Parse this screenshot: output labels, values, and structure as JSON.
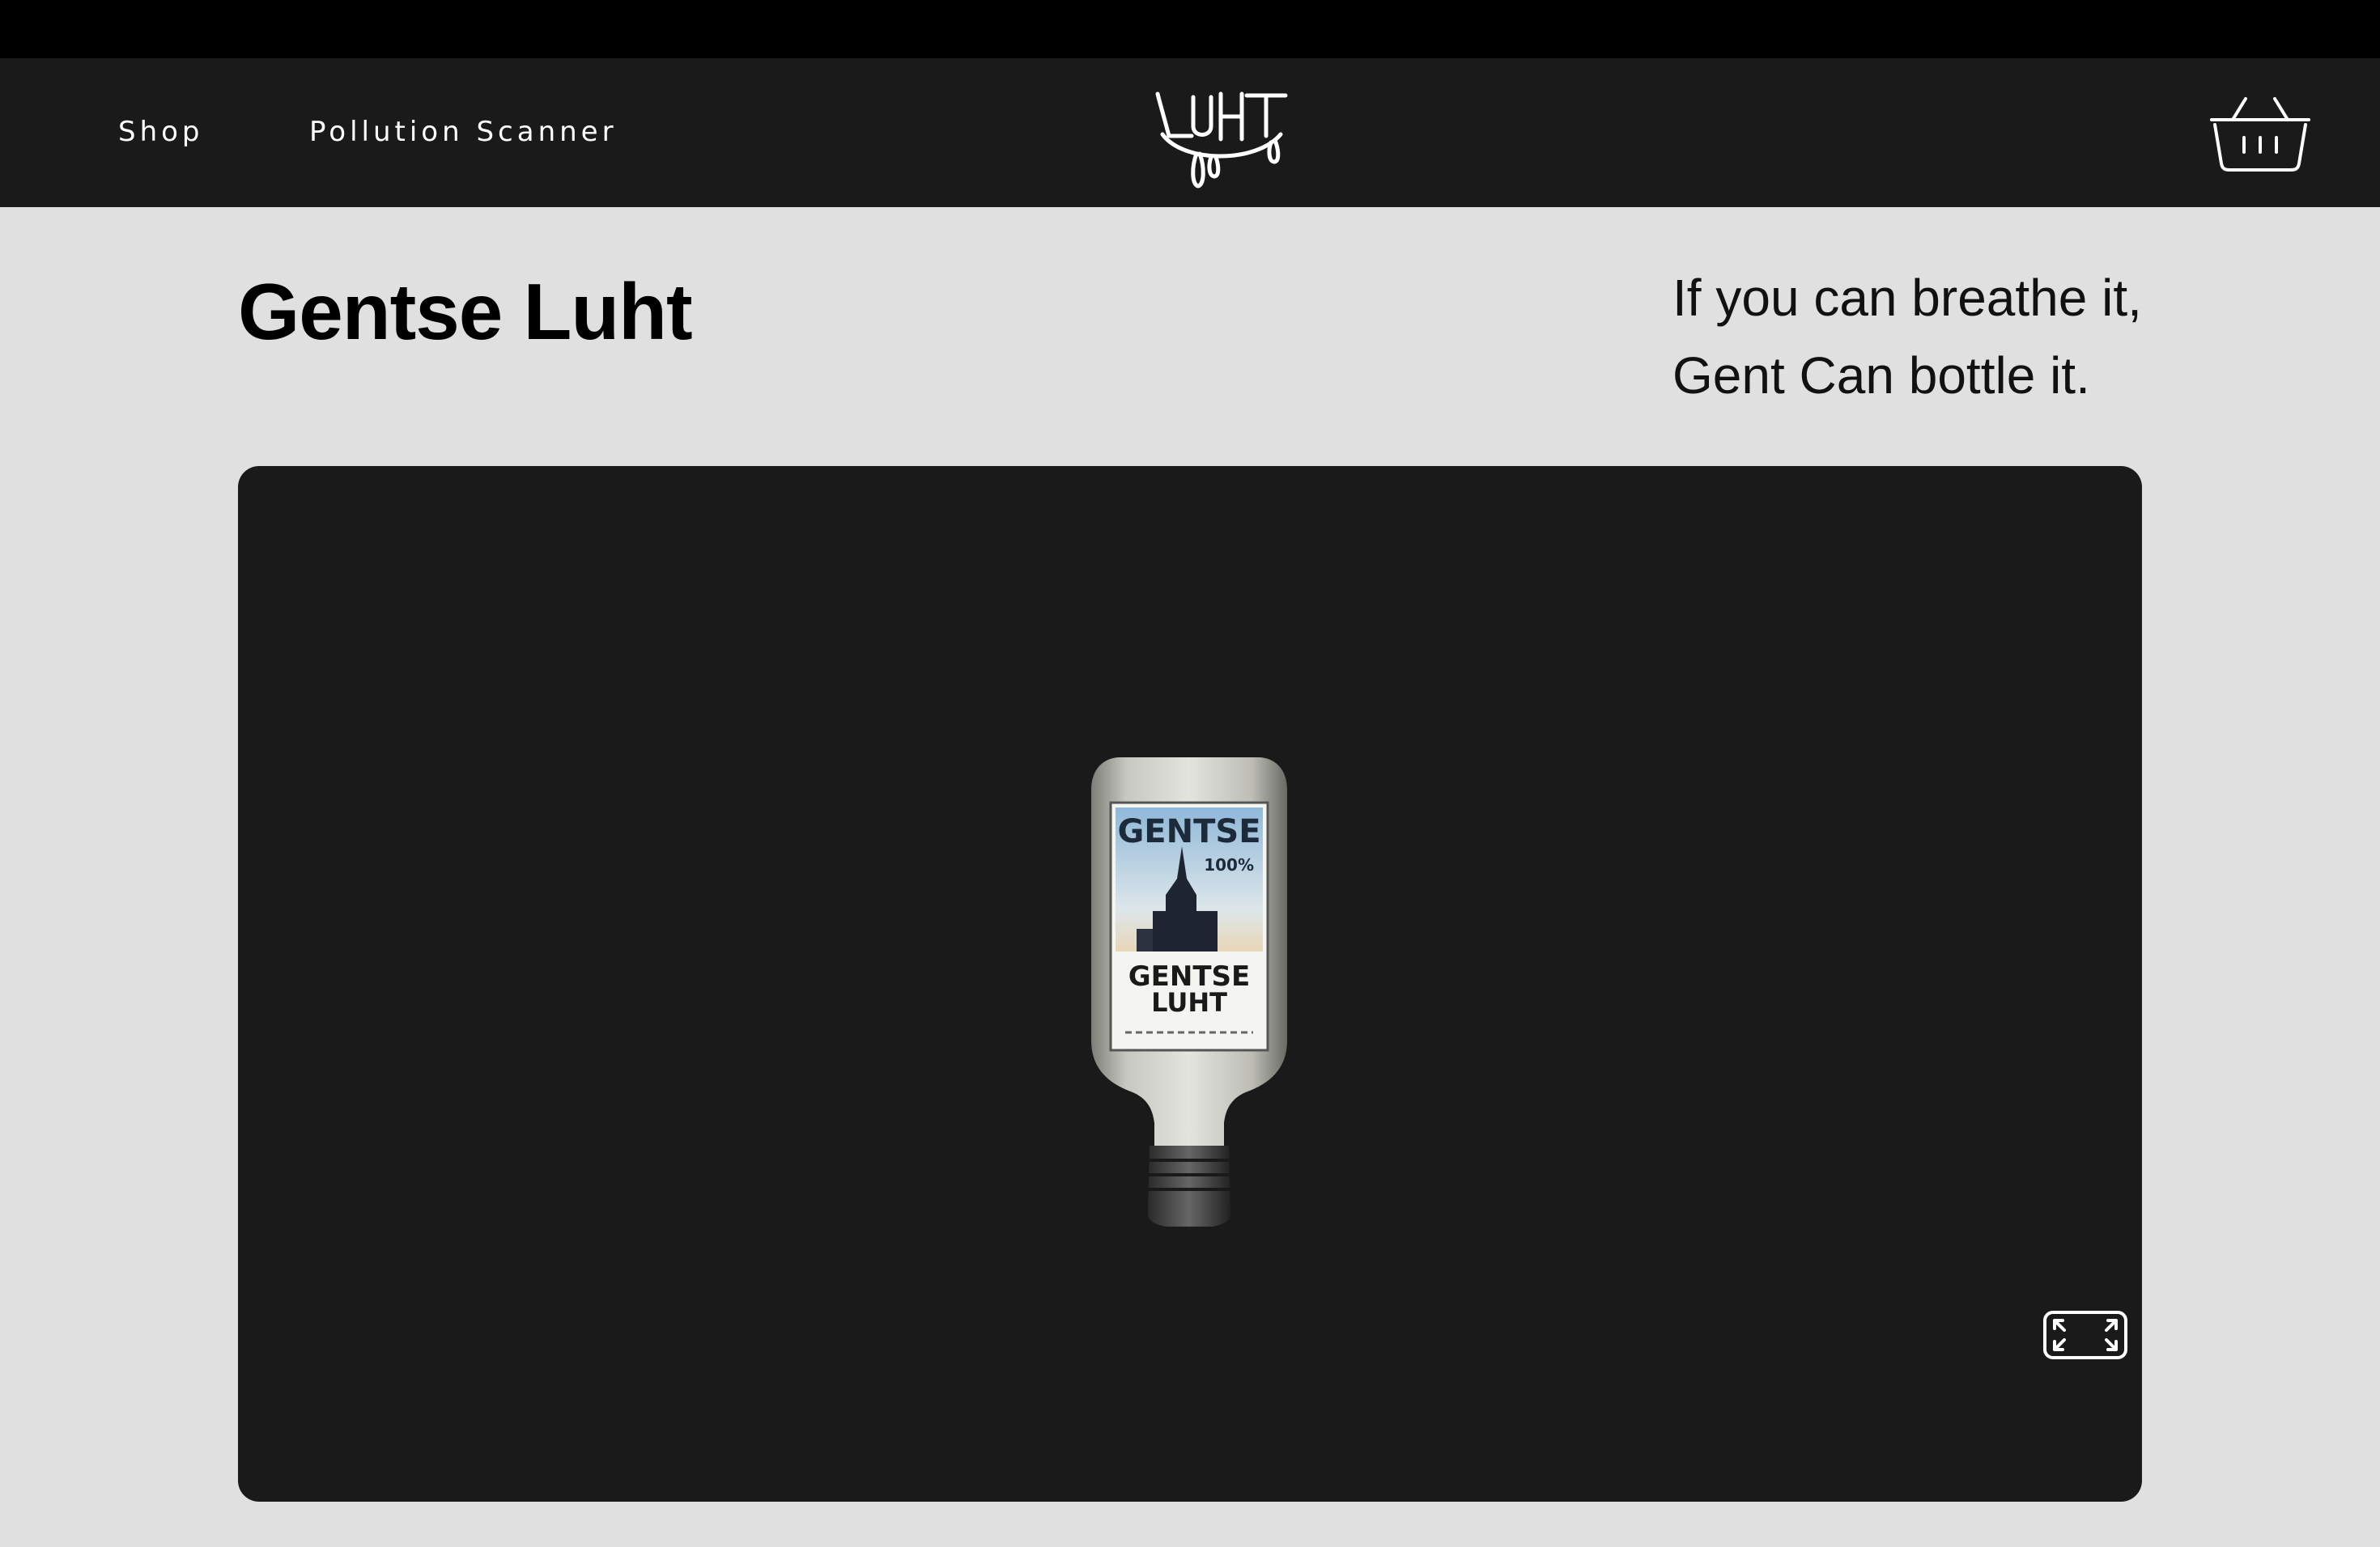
{
  "nav": {
    "items": [
      {
        "label": "Shop"
      },
      {
        "label": "Pollution Scanner"
      }
    ],
    "logo_text": "LUHT",
    "cart_icon": "basket-icon"
  },
  "hero": {
    "title": "Gentse Luht",
    "tagline_line1": "If you can breathe it,",
    "tagline_line2": "Gent Can bottle it."
  },
  "product_viewer": {
    "label_top": "GENTSE",
    "label_badge": "100%",
    "label_bottom_1": "GENTSE",
    "label_bottom_2": "LUHT",
    "fullscreen_icon": "expand-icon"
  },
  "colors": {
    "topbar": "#000000",
    "navbar": "#1a1a1a",
    "page_bg": "#e0e0e0",
    "viewer_bg": "#1a1a1a",
    "text_dark": "#000000",
    "text_light": "#ffffff"
  }
}
